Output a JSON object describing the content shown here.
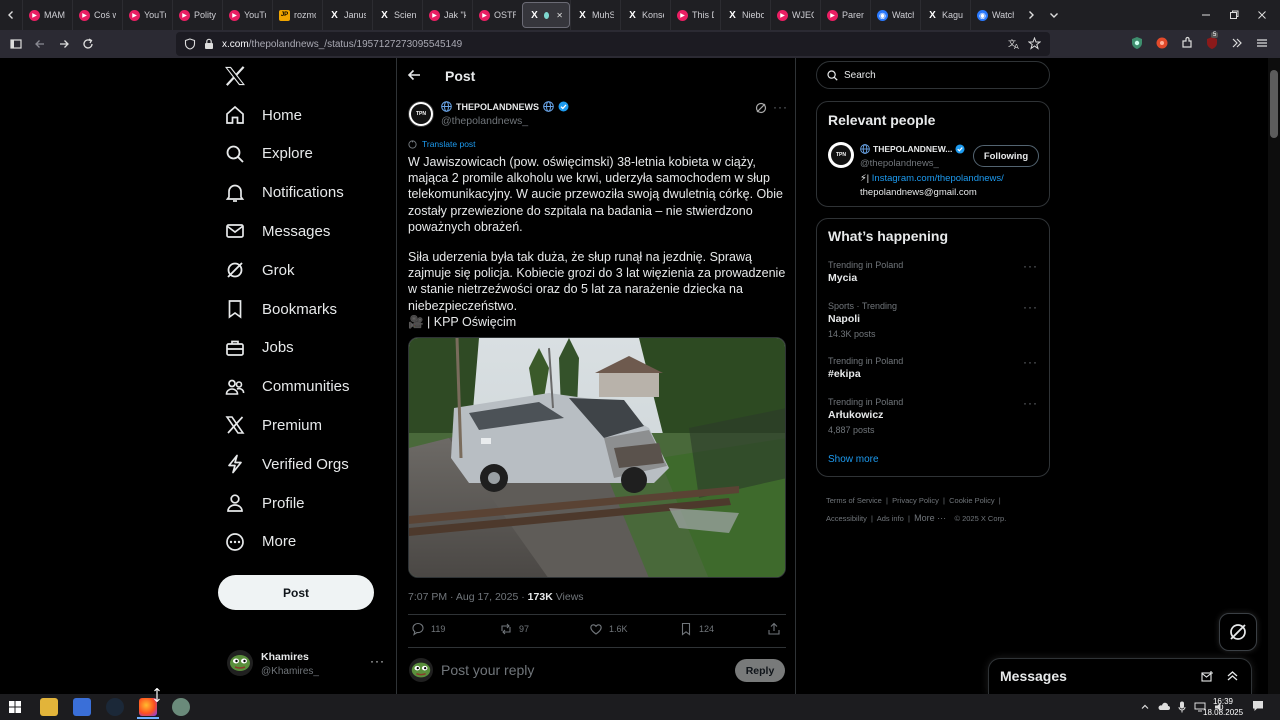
{
  "browser": {
    "tabs": [
      {
        "title": "MAM",
        "fav": "▶",
        "color": "#e91e63"
      },
      {
        "title": "Coś w",
        "fav": "▶",
        "color": "#e91e63"
      },
      {
        "title": "YouTu",
        "fav": "▶",
        "color": "#e91e63"
      },
      {
        "title": "Polity",
        "fav": "▶",
        "color": "#e91e63"
      },
      {
        "title": "YouTu",
        "fav": "▶",
        "color": "#e91e63"
      },
      {
        "title": "rozmc",
        "fav": "JP",
        "color": "#f0a500"
      },
      {
        "title": "Janus",
        "fav": "X",
        "color": "#ffffff"
      },
      {
        "title": "Scienc",
        "fav": "X",
        "color": "#ffffff"
      },
      {
        "title": "Jak \"k",
        "fav": "▶",
        "color": "#e91e63"
      },
      {
        "title": "OSTR",
        "fav": "▶",
        "color": "#e91e63"
      },
      {
        "title": "",
        "fav": "X",
        "color": "#ffffff",
        "active": true
      },
      {
        "title": "MuhSi",
        "fav": "X",
        "color": "#ffffff"
      },
      {
        "title": "Konse",
        "fav": "X",
        "color": "#ffffff"
      },
      {
        "title": "This D",
        "fav": "▶",
        "color": "#e91e63"
      },
      {
        "title": "Niebo",
        "fav": "X",
        "color": "#ffffff"
      },
      {
        "title": "WJEC",
        "fav": "▶",
        "color": "#e91e63"
      },
      {
        "title": "Paren",
        "fav": "▶",
        "color": "#e91e63"
      },
      {
        "title": "Watch",
        "fav": "◉",
        "color": "#2979ff"
      },
      {
        "title": "Kagu",
        "fav": "X",
        "color": "#ffffff"
      },
      {
        "title": "Watch",
        "fav": "◉",
        "color": "#2979ff"
      }
    ],
    "url_main": "x.com",
    "url_path": "/thepolandnews_/status/1957127273095545149",
    "ext_badge": "5"
  },
  "nav": {
    "items": [
      {
        "label": "Home",
        "icon": "home-icon"
      },
      {
        "label": "Explore",
        "icon": "search-icon"
      },
      {
        "label": "Notifications",
        "icon": "bell-icon"
      },
      {
        "label": "Messages",
        "icon": "mail-icon"
      },
      {
        "label": "Grok",
        "icon": "grok-icon"
      },
      {
        "label": "Bookmarks",
        "icon": "bookmark-icon"
      },
      {
        "label": "Jobs",
        "icon": "briefcase-icon"
      },
      {
        "label": "Communities",
        "icon": "people-icon"
      },
      {
        "label": "Premium",
        "icon": "x-logo-icon"
      },
      {
        "label": "Verified Orgs",
        "icon": "lightning-icon"
      },
      {
        "label": "Profile",
        "icon": "person-icon"
      },
      {
        "label": "More",
        "icon": "more-circle-icon"
      }
    ],
    "post_label": "Post",
    "account": {
      "name": "Khamires",
      "handle": "@Khamires_"
    }
  },
  "post": {
    "header_title": "Post",
    "author_name": "THEPOLANDNEWS",
    "author_handle": "@thepolandnews_",
    "translate_label": "Translate post",
    "paragraph1": "W Jawiszowicach (pow. oświęcimski) 38-letnia kobieta w ciąży, mająca 2 promile alkoholu we krwi, uderzyła samochodem w słup telekomunikacyjny. W aucie przewoziła swoją dwuletnią córkę. Obie zostały przewiezione do szpitala na badania – nie stwierdzono poważnych obrażeń.",
    "paragraph2": "Siła uderzenia była tak duża, że słup runął na jezdnię. Sprawą zajmuje się policja. Kobiecie grozi do 3 lat więzienia za prowadzenie w stanie nietrzeźwości oraz do 5 lat za narażenie dziecka na niebezpieczeństwo.",
    "paragraph3": "🎥 | KPP Oświęcim",
    "timestamp": "7:07 PM · Aug 17, 2025 ·",
    "views_count": "173K",
    "views_label": "Views",
    "replies": "119",
    "reposts": "97",
    "likes": "1.6K",
    "bookmarks": "124",
    "reply_placeholder": "Post your reply",
    "reply_button": "Reply"
  },
  "sidebar": {
    "search_placeholder": "Search",
    "relevant_title": "Relevant people",
    "person_name": "THEPOLANDNEW...",
    "person_handle": "@thepolandnews_",
    "follow_label": "Following",
    "bio_link": "Instagram.com/thepolandnews/",
    "bio_prefix": "⚡|",
    "bio_email": "thepolandnews@gmail.com",
    "happening_title": "What’s happening",
    "trends": [
      {
        "category": "Trending in Poland",
        "name": "Mycia",
        "count": ""
      },
      {
        "category": "Sports · Trending",
        "name": "Napoli",
        "count": "14.3K posts"
      },
      {
        "category": "Trending in Poland",
        "name": "#ekipa",
        "count": ""
      },
      {
        "category": "Trending in Poland",
        "name": "Arłukowicz",
        "count": "4,887 posts"
      }
    ],
    "show_more": "Show more",
    "footer": {
      "terms": "Terms of Service",
      "privacy": "Privacy Policy",
      "cookie": "Cookie Policy",
      "accessibility": "Accessibility",
      "ads": "Ads info",
      "more": "More ···",
      "copyright": "© 2025 X Corp."
    },
    "messages_title": "Messages"
  },
  "taskbar": {
    "time": "16:39",
    "date": "18.08.2025"
  }
}
